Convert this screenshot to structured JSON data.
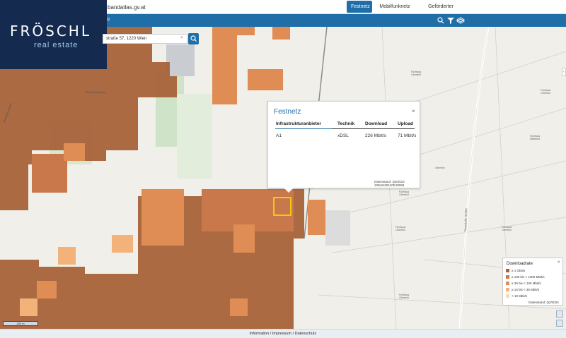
{
  "header": {
    "url": "bandatlas.gv.at",
    "tabs": [
      {
        "label": "Festnetz",
        "active": true
      },
      {
        "label": "Mobilfunknetz",
        "active": false
      },
      {
        "label": "Geförderter Ausbau",
        "active": false
      }
    ]
  },
  "toolbar": {
    "partial_text": "tz",
    "icons": [
      "search-icon",
      "filter-icon",
      "layers-icon"
    ]
  },
  "logo": {
    "name": "FRÖSCHL",
    "sub": "real estate"
  },
  "search": {
    "value": "straße 57, 1220 Wien",
    "clear": "×"
  },
  "popup": {
    "title": "Festnetz",
    "close": "×",
    "columns": [
      "Infrastrukturanbieter",
      "Technik",
      "Download",
      "Upload"
    ],
    "rows": [
      [
        "A1",
        "xDSL",
        "226 Mbit/s",
        "71 Mbit/s"
      ]
    ],
    "datenstand": "Datenstand: Q3/2024",
    "cell_id": "100mN28110E48068"
  },
  "legend": {
    "title": "Downloadrate",
    "close": "×",
    "items": [
      {
        "label": "≥ 1 Gbit/s",
        "color": "#a8623a"
      },
      {
        "label": "≥ 100 bis < 1000 Mbit/s",
        "color": "#c8784a"
      },
      {
        "label": "≥ 30 bis < 100 Mbit/s",
        "color": "#e08d55"
      },
      {
        "label": "≥ 10 bis < 30 Mbit/s",
        "color": "#f2b27a"
      },
      {
        "label": "< 10 Mbit/s",
        "color": "#f9dcb5"
      }
    ],
    "datenstand": "Datenstand: Q3/2024"
  },
  "map_labels": {
    "l1": "Fünfhaus Oberfeld",
    "l2": "Fünfhaus Mittelfeld",
    "l3": "Oberfeld",
    "l4": "Fünfhaus Oberfeld",
    "l5": "Fünfhaus Oberfeld",
    "l6": "Fünfhaus Oberfeld",
    "l7": "Fünfhaus Oberfeld",
    "l8": "Fünfhaus Oberfeld",
    "road1": "Weinsbergerweg",
    "road2": "Teichackergasse",
    "road3": "Raasdorfer Straße"
  },
  "scale": "200 m",
  "footer": "Information / Impressum / Datenschutz"
}
